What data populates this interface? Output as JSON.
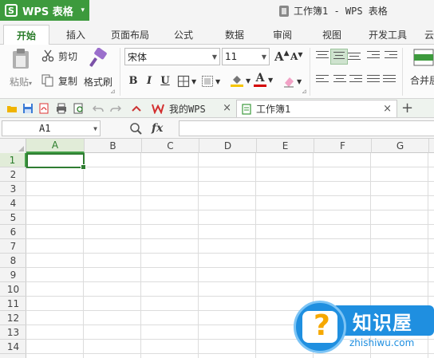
{
  "app": {
    "logo": "S",
    "name": "WPS 表格",
    "menu_caret": "▾"
  },
  "window": {
    "title": "工作簿1 - WPS 表格"
  },
  "ribbon_tabs": [
    "开始",
    "插入",
    "页面布局",
    "公式",
    "数据",
    "审阅",
    "视图",
    "开发工具",
    "云"
  ],
  "active_tab": "开始",
  "ribbon": {
    "cut": "剪切",
    "paste": "粘贴",
    "paste_caret": "▾",
    "copy": "复制",
    "format_painter": "格式刷",
    "font_name": "宋体",
    "font_size": "11",
    "bold": "B",
    "italic": "I",
    "underline": "U",
    "grow_font": "A",
    "shrink_font": "A",
    "font_color_letter": "A",
    "merge_center": "合并居"
  },
  "doc_tabs": [
    {
      "label": "我的WPS",
      "close": "×",
      "active": false
    },
    {
      "label": "工作簿1",
      "close": "×",
      "active": true
    }
  ],
  "new_tab_label": "+",
  "formula_bar": {
    "name_box": "A1",
    "fx_label": "fx",
    "formula": ""
  },
  "columns": [
    "A",
    "B",
    "C",
    "D",
    "E",
    "F",
    "G"
  ],
  "rows": [
    "1",
    "2",
    "3",
    "4",
    "5",
    "6",
    "7",
    "8",
    "9",
    "10",
    "11",
    "12",
    "13",
    "14"
  ],
  "active_cell": {
    "column": "A",
    "row": "1"
  },
  "watermark": {
    "main": "知识屋",
    "sub": "zhishiwu.com"
  },
  "colors": {
    "brand_green": "#3d9a3d",
    "selection_green": "#2f7d32",
    "watermark_blue": "#1f8fe0"
  }
}
